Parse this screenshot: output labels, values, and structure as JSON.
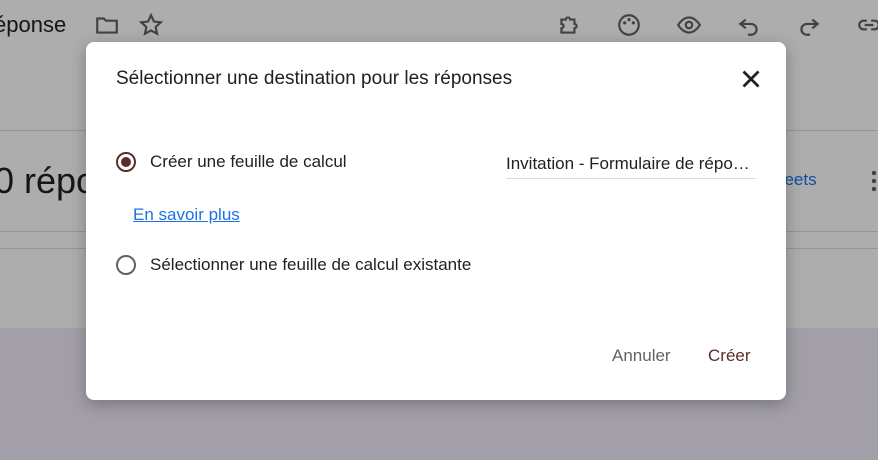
{
  "background": {
    "doc_title": "éponse",
    "responses_count": "0 répo",
    "sheets_link": "heets"
  },
  "icons": {
    "toolbar": [
      "folder-icon",
      "star-icon",
      "addon-icon",
      "palette-icon",
      "eye-icon",
      "undo-icon",
      "redo-icon",
      "link-icon"
    ]
  },
  "dialog": {
    "title": "Sélectionner une destination pour les réponses",
    "option_new_label": "Créer une feuille de calcul",
    "option_existing_label": "Sélectionner une feuille de calcul existante",
    "new_sheet_name": "Invitation - Formulaire de réponses",
    "learn_more": "En savoir plus",
    "cancel_label": "Annuler",
    "create_label": "Créer",
    "selected_option": "new"
  },
  "colors": {
    "accent": "#5a2e2a",
    "link": "#1a73e8"
  }
}
